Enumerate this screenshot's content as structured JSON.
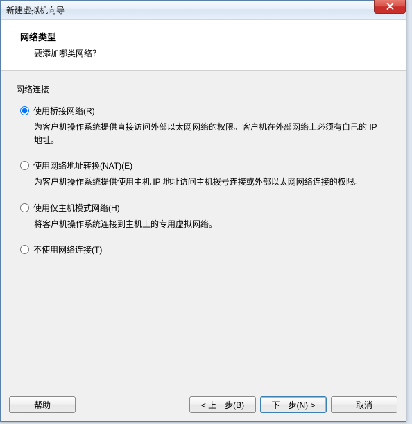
{
  "titlebar": {
    "title": "新建虚拟机向导"
  },
  "header": {
    "title": "网络类型",
    "subtitle": "要添加哪类网络？"
  },
  "group_label": "网络连接",
  "options": {
    "bridged": {
      "label": "使用桥接网络(R)",
      "desc": "为客户机操作系统提供直接访问外部以太网网络的权限。客户机在外部网络上必须有自己的 IP 地址。"
    },
    "nat": {
      "label": "使用网络地址转换(NAT)(E)",
      "desc": "为客户机操作系统提供使用主机 IP 地址访问主机拨号连接或外部以太网网络连接的权限。"
    },
    "hostonly": {
      "label": "使用仅主机模式网络(H)",
      "desc": "将客户机操作系统连接到主机上的专用虚拟网络。"
    },
    "none": {
      "label": "不使用网络连接(T)"
    }
  },
  "buttons": {
    "help": "帮助",
    "back": "< 上一步(B)",
    "next": "下一步(N) >",
    "cancel": "取消"
  }
}
